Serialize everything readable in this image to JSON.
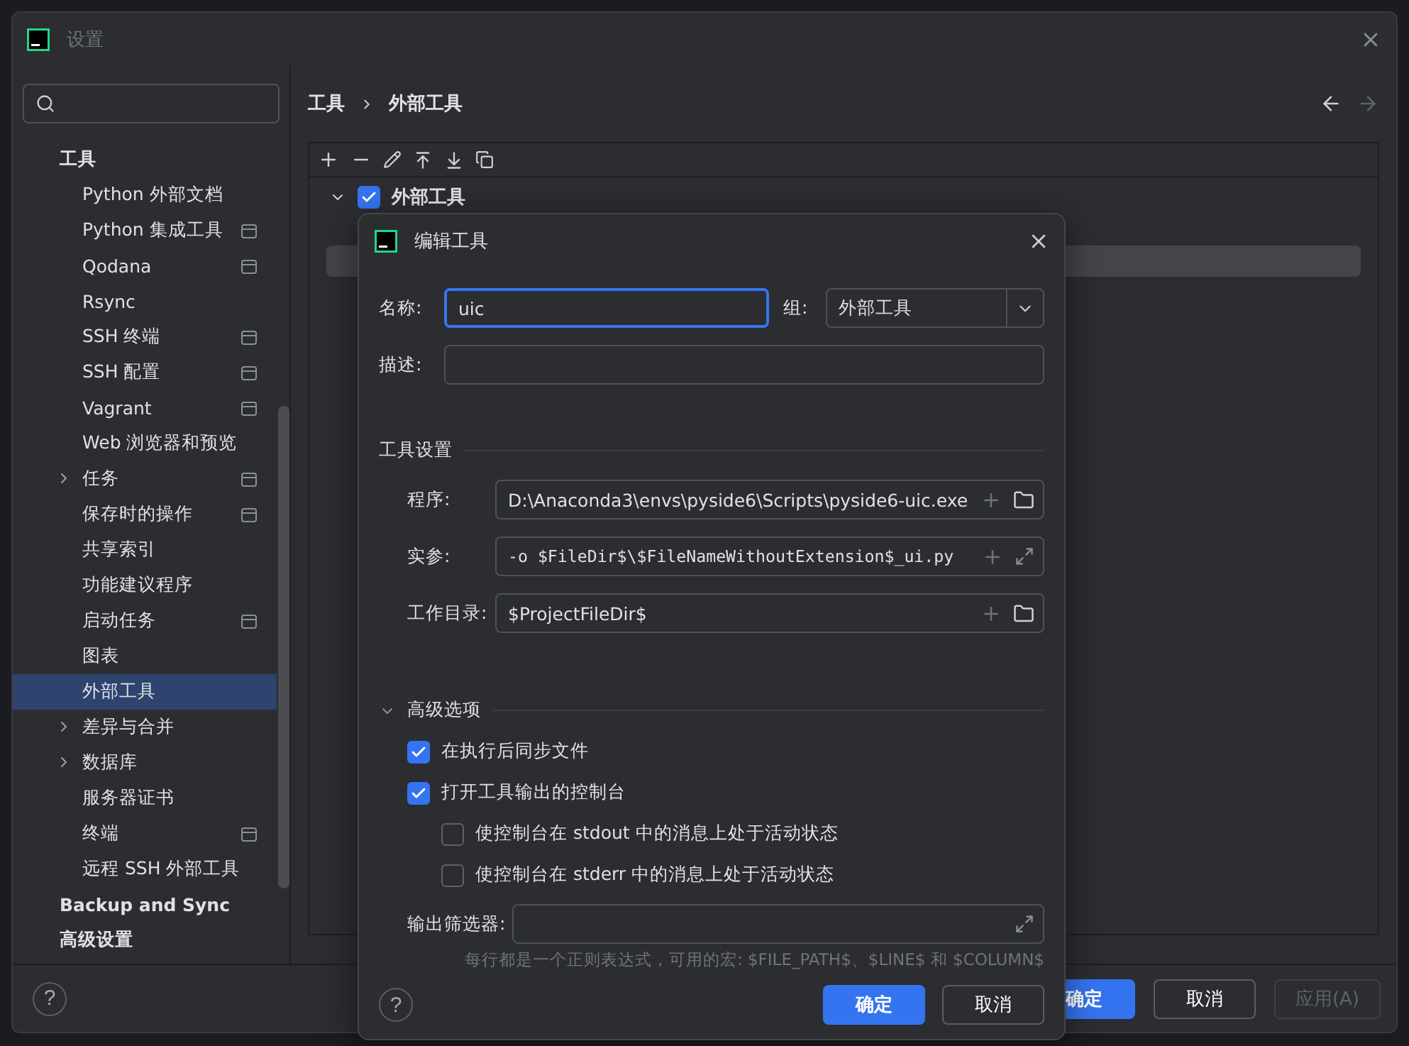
{
  "window": {
    "title": "设置"
  },
  "sidebar": {
    "items": [
      {
        "label": "工具",
        "selected": false,
        "project_icon": false,
        "children": [
          {
            "label": "Python 外部文档",
            "kind": "page",
            "selected": false,
            "project_icon": false
          },
          {
            "label": "Python 集成工具",
            "kind": "page",
            "selected": false,
            "project_icon": true
          },
          {
            "label": "Qodana",
            "kind": "page",
            "selected": false,
            "project_icon": true
          },
          {
            "label": "Rsync",
            "kind": "page",
            "selected": false,
            "project_icon": false
          },
          {
            "label": "SSH 终端",
            "kind": "page",
            "selected": false,
            "project_icon": true
          },
          {
            "label": "SSH 配置",
            "kind": "page",
            "selected": false,
            "project_icon": true
          },
          {
            "label": "Vagrant",
            "kind": "page",
            "selected": false,
            "project_icon": true
          },
          {
            "label": "Web 浏览器和预览",
            "kind": "page",
            "selected": false,
            "project_icon": false
          },
          {
            "label": "任务",
            "kind": "folder",
            "selected": false,
            "project_icon": true
          },
          {
            "label": "保存时的操作",
            "kind": "page",
            "selected": false,
            "project_icon": true
          },
          {
            "label": "共享索引",
            "kind": "page",
            "selected": false,
            "project_icon": false
          },
          {
            "label": "功能建议程序",
            "kind": "page",
            "selected": false,
            "project_icon": false
          },
          {
            "label": "启动任务",
            "kind": "page",
            "selected": false,
            "project_icon": true
          },
          {
            "label": "图表",
            "kind": "page",
            "selected": false,
            "project_icon": false
          },
          {
            "label": "外部工具",
            "kind": "page",
            "selected": true,
            "project_icon": false
          },
          {
            "label": "差异与合并",
            "kind": "folder",
            "selected": false,
            "project_icon": false
          },
          {
            "label": "数据库",
            "kind": "folder",
            "selected": false,
            "project_icon": false
          },
          {
            "label": "服务器证书",
            "kind": "page",
            "selected": false,
            "project_icon": false
          },
          {
            "label": "终端",
            "kind": "page",
            "selected": false,
            "project_icon": true
          },
          {
            "label": "远程 SSH 外部工具",
            "kind": "page",
            "selected": false,
            "project_icon": false
          }
        ]
      },
      {
        "label": "Backup and Sync",
        "selected": false,
        "project_icon": false
      },
      {
        "label": "高级设置",
        "selected": false,
        "project_icon": false
      }
    ]
  },
  "breadcrumb": [
    "工具",
    "外部工具"
  ],
  "help": "?",
  "tools_tree": {
    "label": "外部工具",
    "checked": true,
    "expanded": true
  },
  "footer": {
    "buttons": [
      {
        "label": "确定",
        "kind": "primary",
        "disabled": false
      },
      {
        "label": "取消",
        "kind": "secondary",
        "disabled": false
      },
      {
        "label": "应用(A)",
        "kind": "secondary",
        "disabled": true
      }
    ]
  },
  "dialog": {
    "title": "编辑工具",
    "name": {
      "label": "名称:",
      "value": "uic"
    },
    "group": {
      "label": "组:",
      "value": "外部工具"
    },
    "description": {
      "label": "描述:"
    },
    "tool_settings": {
      "title": "工具设置",
      "fields": [
        {
          "label": "程序:",
          "value": "D:\\Anaconda3\\envs\\pyside6\\Scripts\\pyside6-uic.exe",
          "kind": "browse"
        },
        {
          "label": "实参:",
          "value": "-o $FileDir$\\$FileNameWithoutExtension$_ui.py",
          "kind": "expand"
        },
        {
          "label": "工作目录:",
          "value": "$ProjectFileDir$",
          "kind": "browse"
        }
      ]
    },
    "advanced": {
      "title": "高级选项",
      "expanded": true,
      "options": [
        {
          "label": "在执行后同步文件",
          "checked": true
        },
        {
          "label": "打开工具输出的控制台",
          "checked": true,
          "children": [
            {
              "label": "使控制台在 stdout 中的消息上处于活动状态",
              "checked": false
            },
            {
              "label": "使控制台在 stderr 中的消息上处于活动状态",
              "checked": false
            }
          ]
        }
      ],
      "output_filter": {
        "label": "输出筛选器:",
        "hint": "每行都是一个正则表达式，可用的宏: $FILE_PATH$、$LINE$ 和 $COLUMN$"
      }
    },
    "help": "?",
    "buttons": [
      {
        "label": "确定",
        "kind": "primary",
        "disabled": false
      },
      {
        "label": "取消",
        "kind": "secondary",
        "disabled": false
      }
    ]
  }
}
